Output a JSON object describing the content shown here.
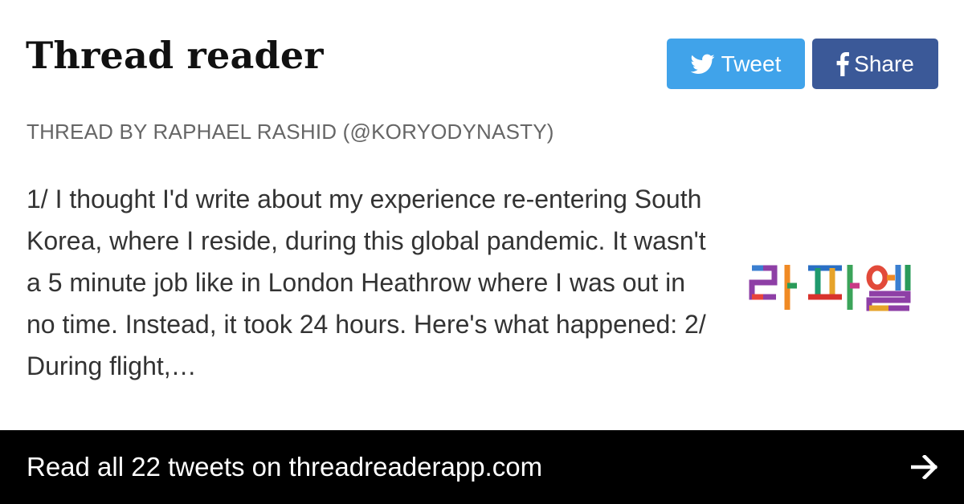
{
  "header": {
    "site_title": "Thread reader",
    "tweet_button": {
      "label": "Tweet",
      "icon": "twitter-bird-icon",
      "color": "#40a3ea"
    },
    "share_button": {
      "label": "Share",
      "icon": "facebook-icon",
      "color": "#3b5998"
    }
  },
  "thread": {
    "byline": "THREAD BY RAPHAEL RASHID (@KORYODYNASTY)",
    "excerpt": "1/ I thought I'd write about my experience re-entering South Korea, where I reside, during this global pandemic. It wasn't a 5 minute job like in London Heathrow where I was out in no time. Instead, it took 24 hours. Here's what happened: 2/ During flight,…",
    "avatar": {
      "text": "라파엘",
      "alt": "profile-avatar"
    }
  },
  "footer": {
    "cta_text": "Read all 22 tweets on threadreaderapp.com",
    "icon": "arrow-right-icon",
    "background": "#000000"
  }
}
